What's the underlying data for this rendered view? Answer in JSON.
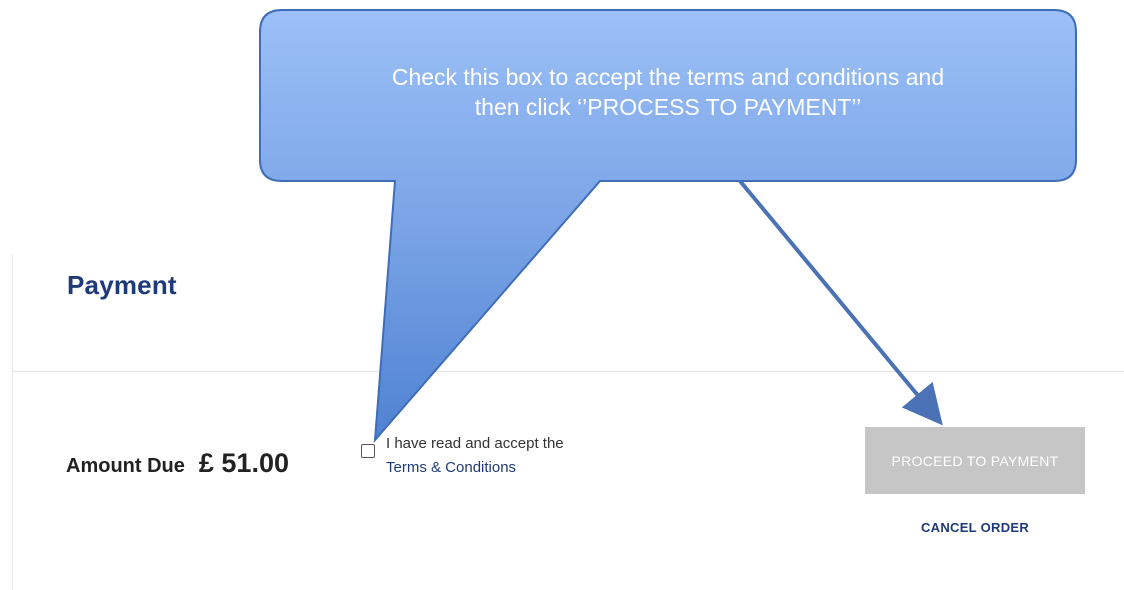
{
  "annotation": {
    "callout_line1": "Check this box to accept the terms and conditions and",
    "callout_line2": "then click ‘’PROCESS TO PAYMENT’’",
    "callout_color": "#7aa4e6",
    "arrow_color": "#4a72b5"
  },
  "payment": {
    "title": "Payment",
    "amount_label": "Amount Due",
    "amount_value": "£ 51.00",
    "terms_prefix": "I have read and accept the",
    "terms_link": "Terms & Conditions",
    "terms_checked": false,
    "proceed_label": "PROCEED TO PAYMENT",
    "proceed_enabled": false,
    "cancel_label": "CANCEL ORDER"
  },
  "colors": {
    "title": "#1f3a78",
    "button_disabled": "#c6c6c6",
    "link": "#1f3a78"
  }
}
